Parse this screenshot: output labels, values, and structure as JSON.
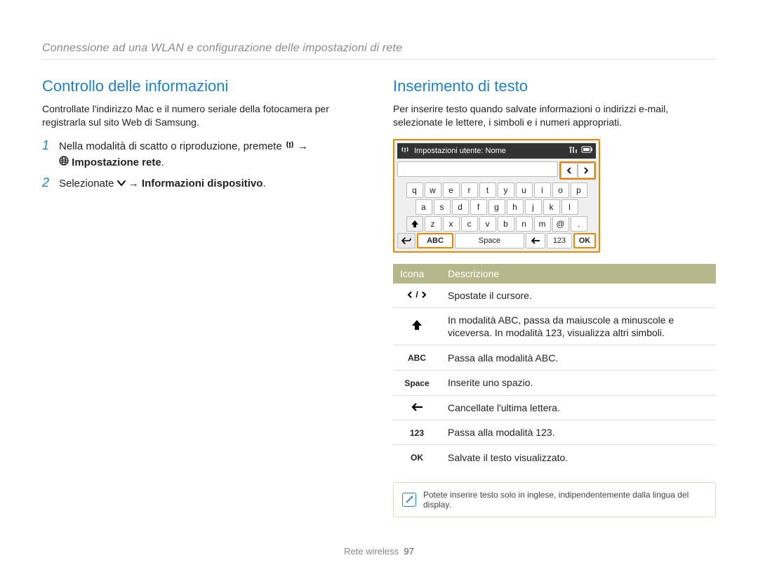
{
  "breadcrumb": "Connessione ad una WLAN e configurazione delle impostazioni di rete",
  "left": {
    "title": "Controllo delle informazioni",
    "intro": "Controllate l'indirizzo Mac e il numero seriale della fotocamera per registrarla sul sito Web di Samsung.",
    "step1_a": "Nella modalità di scatto o riproduzione, premete",
    "step1_b": "Impostazione rete",
    "step2_a": "Selezionate",
    "step2_b": "Informazioni dispositivo"
  },
  "right": {
    "title": "Inserimento di testo",
    "intro": "Per inserire testo quando salvate informazioni o indirizzi e-mail, selezionate le lettere, i simboli e i numeri appropriati.",
    "kb": {
      "header": "Impostazioni utente: Nome",
      "row1": [
        "q",
        "w",
        "e",
        "r",
        "t",
        "y",
        "u",
        "i",
        "o",
        "p"
      ],
      "row2": [
        "a",
        "s",
        "d",
        "f",
        "g",
        "h",
        "j",
        "k",
        "l"
      ],
      "row3": [
        "z",
        "x",
        "c",
        "v",
        "b",
        "n",
        "m",
        "@",
        "."
      ],
      "abc": "ABC",
      "space": "Space",
      "n123": "123",
      "ok": "OK"
    },
    "table": {
      "h1": "Icona",
      "h2": "Descrizione",
      "rows": [
        {
          "icon": "cursor",
          "desc": "Spostate il cursore."
        },
        {
          "icon": "shift",
          "desc": "In modalità ABC, passa da maiuscole a minuscole e viceversa. In modalità 123, visualizza altri simboli."
        },
        {
          "icon": "abc",
          "label": "ABC",
          "desc": "Passa alla modalità ABC."
        },
        {
          "icon": "space",
          "label": "Space",
          "desc": "Inserite uno spazio."
        },
        {
          "icon": "bsp",
          "desc": "Cancellate l'ultima lettera."
        },
        {
          "icon": "n123",
          "label": "123",
          "desc": "Passa alla modalità 123."
        },
        {
          "icon": "ok",
          "label": "OK",
          "desc": "Salvate il testo visualizzato."
        }
      ]
    },
    "note": "Potete inserire testo solo in inglese, indipendentemente dalla lingua del display."
  },
  "footer": {
    "section": "Rete wireless",
    "page": "97"
  }
}
